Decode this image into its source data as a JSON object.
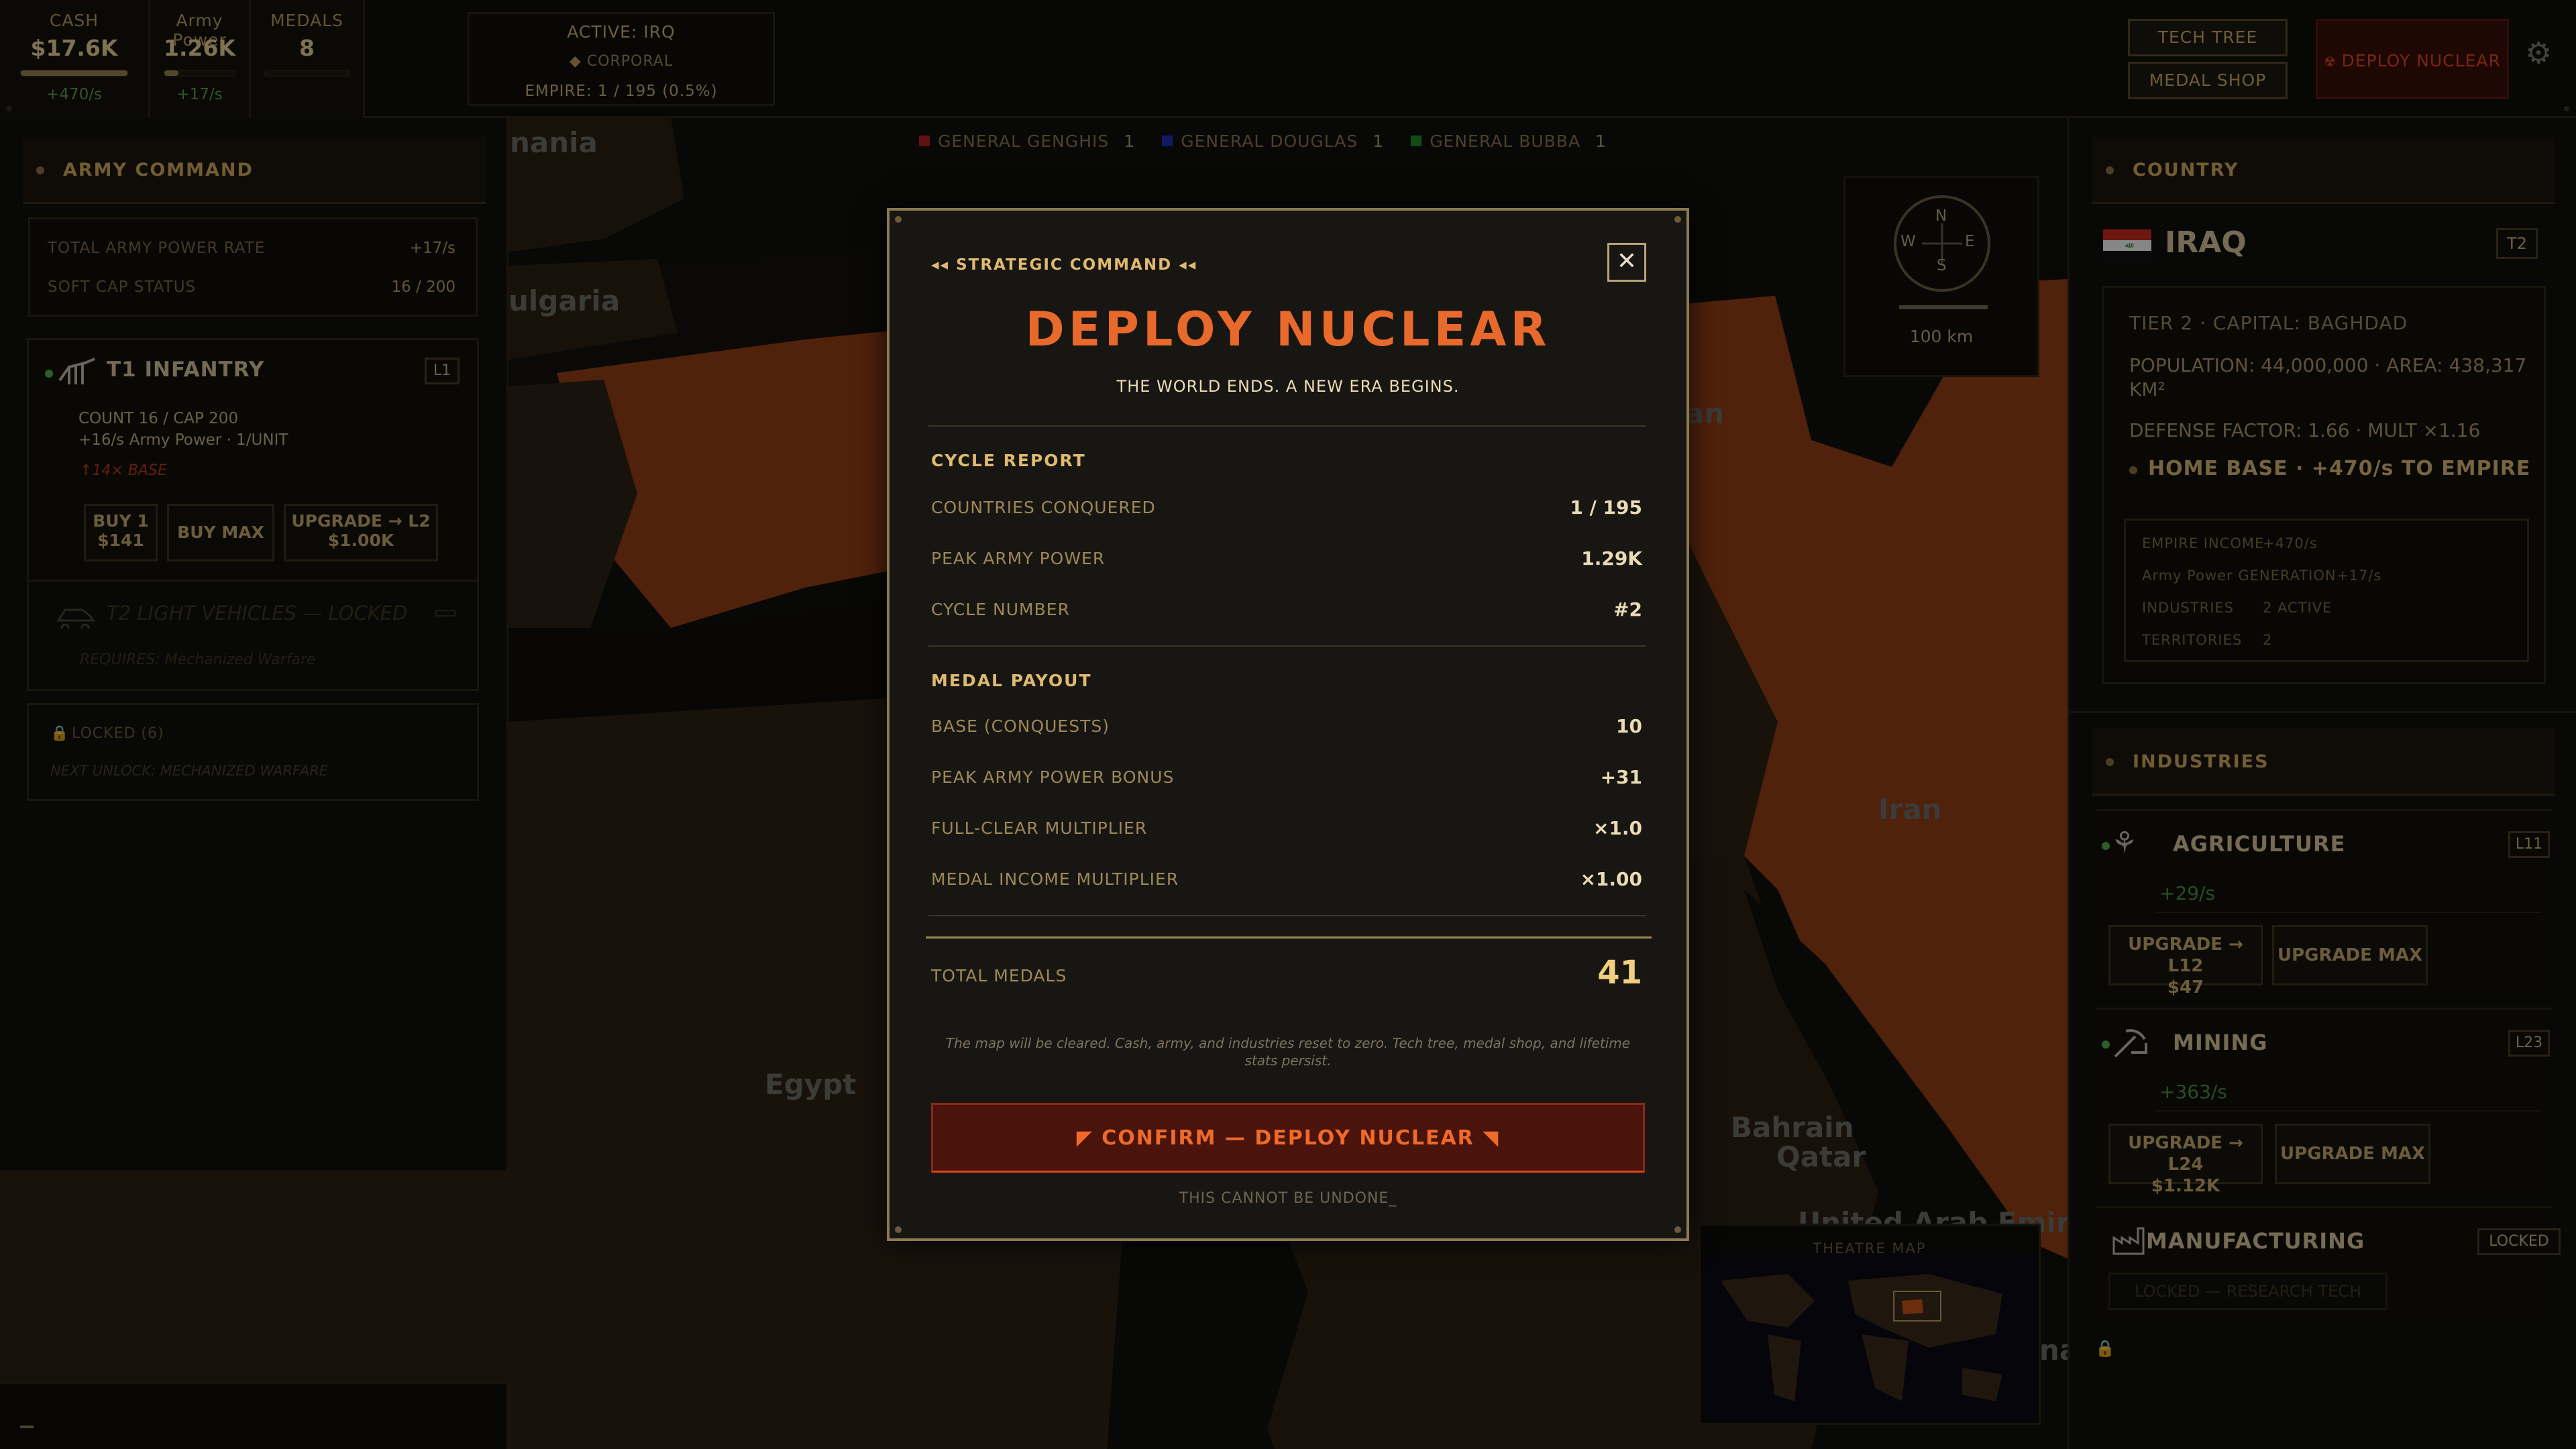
{
  "topbar": {
    "cash": {
      "label": "CASH",
      "value": "$17.6K",
      "rate": "+470/s",
      "progress": 1.0
    },
    "army_power": {
      "label": "Army Power",
      "value": "1.26K",
      "rate": "+17/s",
      "progress": 0.2
    },
    "medals": {
      "label": "MEDALS",
      "value": "8",
      "progress": 0.0
    },
    "active": {
      "label": "ACTIVE: IRQ",
      "rank": "CORPORAL",
      "empire": "EMPIRE: 1 / 195 (0.5%)"
    },
    "tech_tree": "TECH TREE",
    "medal_shop": "MEDAL SHOP",
    "deploy_nuclear": "DEPLOY NUCLEAR"
  },
  "generals": [
    {
      "name": "GENERAL GENGHIS",
      "count": "1",
      "color": "#b02020"
    },
    {
      "name": "GENERAL DOUGLAS",
      "count": "1",
      "color": "#2030b0"
    },
    {
      "name": "GENERAL BUBBA",
      "count": "1",
      "color": "#1f8a2a"
    }
  ],
  "army_command": {
    "title": "ARMY COMMAND",
    "rate_label": "TOTAL ARMY POWER RATE",
    "rate_value": "+17/s",
    "softcap_label": "SOFT CAP STATUS",
    "softcap_value": "16 / 200",
    "units": {
      "t1": {
        "name": "T1 INFANTRY",
        "level": "L1",
        "count": "COUNT 16 / CAP 200",
        "power": "+16/s Army Power  ·  1/UNIT",
        "boost": "↑14× BASE",
        "buy1": "BUY 1",
        "buy1_price": "$141",
        "buymax": "BUY MAX",
        "upgrade": "UPGRADE → L2",
        "upgrade_price": "$1.00K"
      },
      "t2": {
        "name": "T2 LIGHT VEHICLES — LOCKED",
        "requires": "REQUIRES: Mechanized Warfare"
      }
    },
    "locked": {
      "label": "LOCKED (6)",
      "next": "NEXT UNLOCK: MECHANIZED WARFARE"
    }
  },
  "country": {
    "title": "COUNTRY",
    "name": "IRAQ",
    "tier_badge": "T2",
    "tier_line": "TIER 2  ·  CAPITAL: BAGHDAD",
    "population_line": "POPULATION: 44,000,000  ·  AREA: 438,317 KM²",
    "defense_line": "DEFENSE FACTOR: 1.66  ·  MULT ×1.16",
    "home_base": "HOME BASE  ·  +470/s TO EMPIRE",
    "stats": [
      {
        "label": "EMPIRE INCOME",
        "value": "+470/s"
      },
      {
        "label": "Army Power GENERATION",
        "value": "+17/s"
      },
      {
        "label": "INDUSTRIES",
        "value": "2 ACTIVE"
      },
      {
        "label": "TERRITORIES",
        "value": "2"
      }
    ]
  },
  "industries": {
    "title": "INDUSTRIES",
    "agriculture": {
      "name": "AGRICULTURE",
      "level": "L11",
      "rate": "+29/s",
      "upgrade": "UPGRADE → L12",
      "price": "$47",
      "upgrade_max": "UPGRADE MAX"
    },
    "mining": {
      "name": "MINING",
      "level": "L23",
      "rate": "+363/s",
      "upgrade": "UPGRADE → L24",
      "price": "$1.12K",
      "upgrade_max": "UPGRADE MAX"
    },
    "manufacturing": {
      "name": "MANUFACTURING",
      "badge": "LOCKED",
      "note": "LOCKED — RESEARCH TECH"
    }
  },
  "map": {
    "labels": {
      "bulgaria": "ulgaria",
      "romania": "nania",
      "egypt": "Egypt",
      "iran": "Iran",
      "bahrain": "Bahrain",
      "qatar": "Qatar",
      "uae": "United Arab Emira",
      "an": "an",
      "na": "na"
    },
    "compass": {
      "n": "N",
      "e": "E",
      "s": "S",
      "w": "W",
      "scale": "100 km"
    },
    "minimap_title": "THEATRE MAP"
  },
  "modal": {
    "kicker": "STRATEGIC COMMAND",
    "title": "DEPLOY NUCLEAR",
    "subtitle": "THE WORLD ENDS. A NEW ERA BEGINS.",
    "cycle_report_title": "CYCLE REPORT",
    "cycle_report": [
      {
        "label": "COUNTRIES CONQUERED",
        "value": "1 / 195"
      },
      {
        "label": "PEAK ARMY POWER",
        "value": "1.29K"
      },
      {
        "label": "CYCLE NUMBER",
        "value": "#2"
      }
    ],
    "medal_payout_title": "MEDAL PAYOUT",
    "medal_payout": [
      {
        "label": "BASE (CONQUESTS)",
        "value": "10"
      },
      {
        "label": "PEAK ARMY POWER BONUS",
        "value": "+31"
      },
      {
        "label": "FULL-CLEAR MULTIPLIER",
        "value": "×1.0"
      },
      {
        "label": "MEDAL INCOME MULTIPLIER",
        "value": "×1.00"
      }
    ],
    "total_label": "TOTAL MEDALS",
    "total_value": "41",
    "note": "The map will be cleared. Cash, army, and industries reset to zero. Tech tree, medal shop, and lifetime stats persist.",
    "confirm": "CONFIRM — DEPLOY NUCLEAR",
    "warning": "THIS CANNOT BE UNDONE_"
  },
  "colors": {
    "accent": "#e86a2c",
    "gold": "#cfa85c",
    "land_owned": "#c5521c",
    "land_other": "#3a2c1c"
  }
}
